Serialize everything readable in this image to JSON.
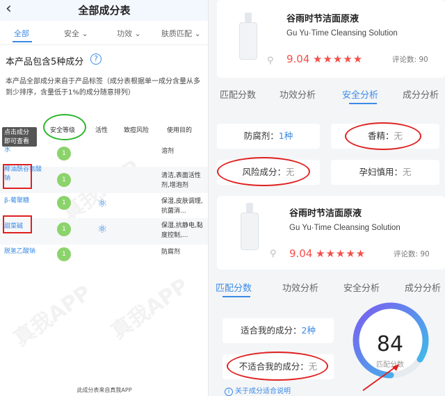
{
  "left": {
    "title": "全部成分表",
    "back_glyph": "‹",
    "tabs": [
      {
        "label": "全部"
      },
      {
        "label": "安全 ⌄"
      },
      {
        "label": "功效 ⌄"
      },
      {
        "label": "肤质匹配 ⌄"
      }
    ],
    "count_text": "本产品包含5种成分",
    "help_glyph": "?",
    "description": "本产品全部成分来自于产品标签（成分表根据单一成分含量从多到少排序，含量低于1%的成分随意排列）",
    "tooltip": "点击成分即可查看",
    "columns": [
      "安全等级",
      "活性",
      "致痘风险",
      "使用目的"
    ],
    "rows": [
      {
        "name": "水",
        "safety": "1",
        "active": false,
        "purpose": "溶剂"
      },
      {
        "name": "椰油酰谷氨酸钠",
        "safety": "1",
        "active": false,
        "purpose": "清洁,表面活性剂,增泡剂"
      },
      {
        "name": "β-葡聚糖",
        "safety": "1",
        "active": true,
        "purpose": "保湿,皮肤调理,抗菌消..."
      },
      {
        "name": "甜菜碱",
        "safety": "1",
        "active": true,
        "purpose": "保湿,抗静电,黏度控制,..."
      },
      {
        "name": "脱氢乙酸钠",
        "safety": "1",
        "active": false,
        "purpose": "防腐剂"
      }
    ],
    "footer": "此成分表来自真我APP",
    "watermark": "真我APP"
  },
  "product": {
    "name": "谷雨时节洁面原液",
    "english": "Gu Yu·Time Cleansing Solution",
    "score": "9.04",
    "stars": "★★★★★",
    "reviews": "评论数: 90"
  },
  "right_tabs": [
    "匹配分数",
    "功效分析",
    "安全分析",
    "成分分析"
  ],
  "safety": {
    "preservative_label": "防腐剂：",
    "preservative_value": "1种",
    "fragrance_label": "香精：",
    "fragrance_value": "无",
    "risk_label": "风险成分：",
    "risk_value": "无",
    "pregnancy_label": "孕妇慎用：",
    "pregnancy_value": "无"
  },
  "match": {
    "suitable_label": "适合我的成分：",
    "suitable_value": "2种",
    "unsuitable_label": "不适合我的成分：",
    "unsuitable_value": "无",
    "score": "84",
    "score_label": "匹配分数",
    "score_fraction": 0.84,
    "link": "关于成分适合说明"
  },
  "colors": {
    "accent": "#3b8be5",
    "score_red": "#f4504b",
    "safe_green": "#8bd36b",
    "highlight_red": "#e02020",
    "highlight_green": "#2cb52c"
  }
}
